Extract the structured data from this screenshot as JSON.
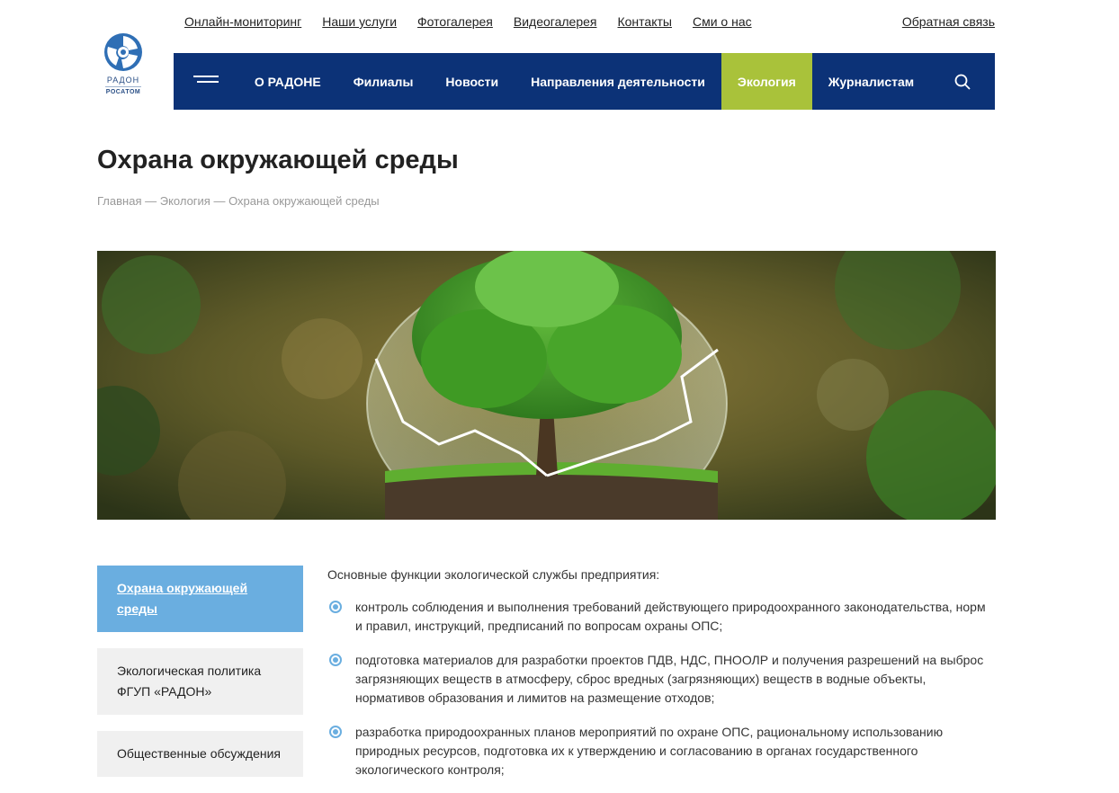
{
  "logo": {
    "line1": "РАДОН",
    "line2": "РОСАТОМ"
  },
  "top_links": [
    "Онлайн-мониторинг",
    "Наши услуги",
    "Фотогалерея",
    "Видеогалерея",
    "Контакты",
    "Сми о нас"
  ],
  "feedback_link": "Обратная связь",
  "nav": {
    "items": [
      "О РАДОНЕ",
      "Филиалы",
      "Новости",
      "Направления деятельности",
      "Экология",
      "Журналистам"
    ],
    "active": "Экология",
    "accent_color": "#0c3277",
    "active_color": "#a9c23a"
  },
  "page_title": "Охрана окружающей среды",
  "breadcrumb": {
    "home": "Главная",
    "sep": " — ",
    "section": "Экология",
    "current": "Охрана окружающей среды"
  },
  "sidebar": {
    "items": [
      "Охрана окружающей среды",
      "Экологическая политика ФГУП «РАДОН»",
      "Общественные обсуждения"
    ],
    "active_color": "#6aaee0"
  },
  "content": {
    "intro": "Основные функции экологической службы предприятия:",
    "bullets": [
      "контроль соблюдения и выполнения требований действующего природоохранного законодательства, норм и правил, инструкций, предписаний по вопросам охраны ОПС;",
      "подготовка материалов для разработки проектов ПДВ, НДС, ПНООЛР и получения разрешений на выброс загрязняющих веществ в атмосферу, сброс вредных (загрязняющих) веществ в водные объекты, нормативов образования и лимитов на размещение отходов;",
      "разработка природоохранных планов мероприятий по охране ОПС, рациональному использованию природных ресурсов, подготовка их к утверждению и согласованию в органах государственного экологического контроля;"
    ]
  }
}
